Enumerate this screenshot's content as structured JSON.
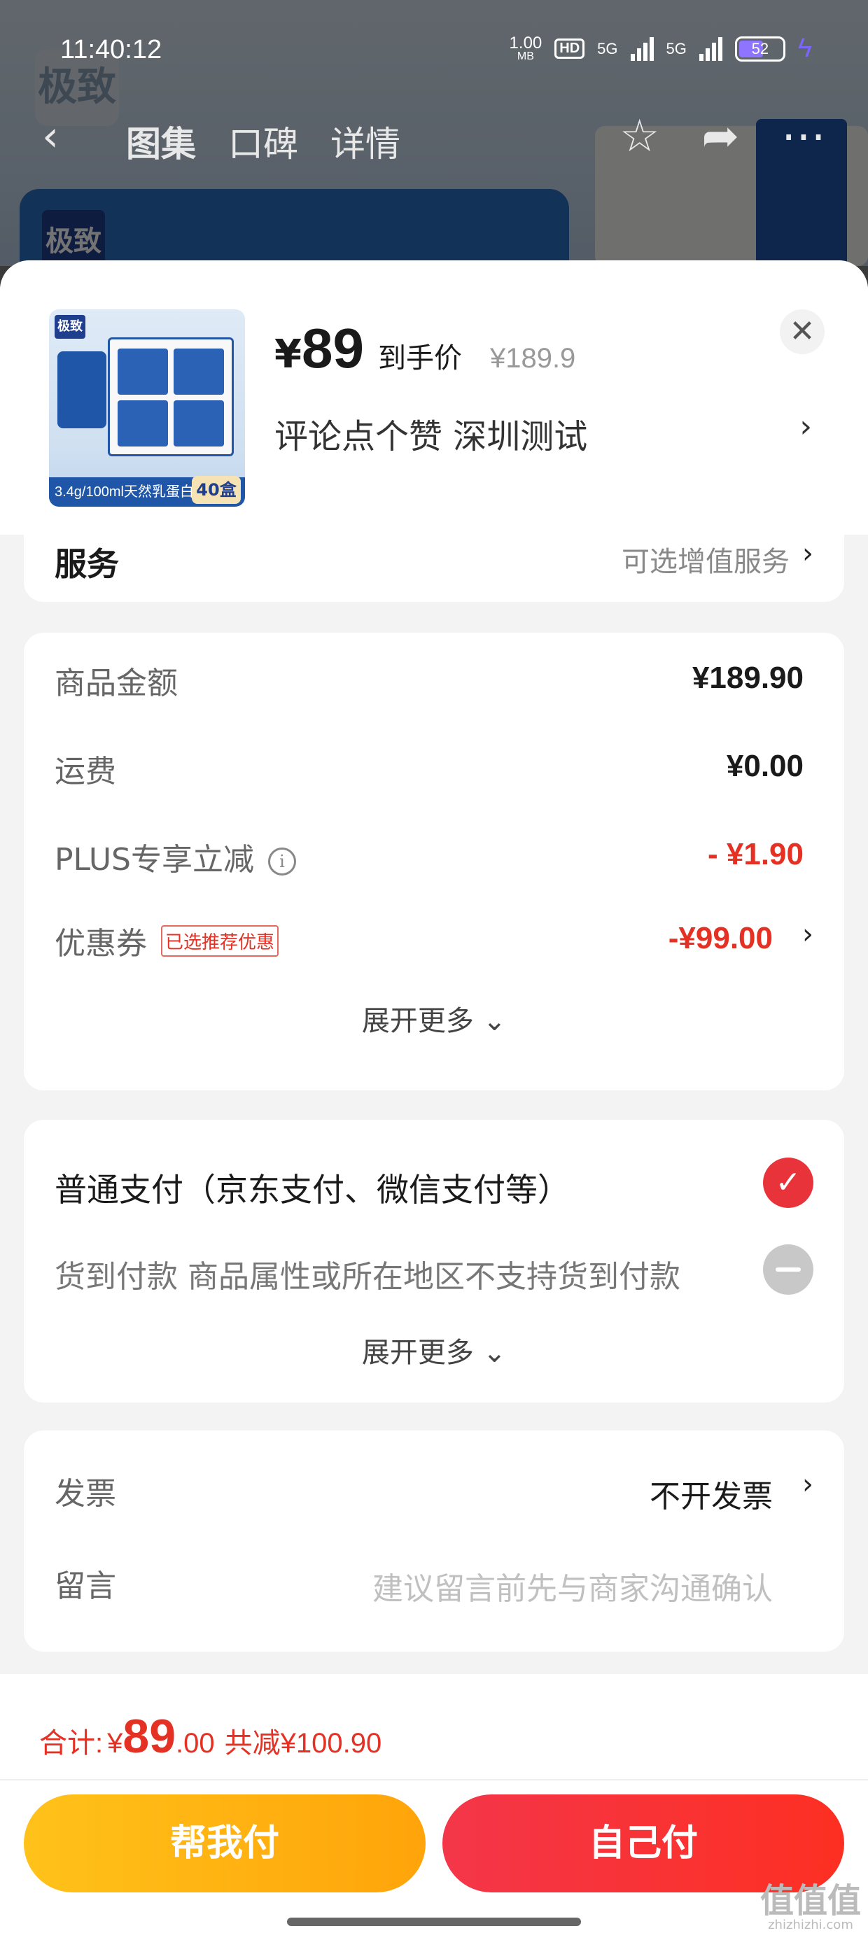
{
  "status": {
    "time": "11:40:12",
    "speed": "1.00",
    "speed_unit": "MB",
    "hd": "HD",
    "net1": "5G",
    "net2": "5G",
    "battery": "52"
  },
  "nav": {
    "tabs": [
      "图集",
      "口碑",
      "详情"
    ],
    "active_tab": 0
  },
  "background": {
    "logo_text": "极致"
  },
  "product": {
    "image_logo": "极致",
    "image_strip": "3.4g/100ml天然乳蛋白",
    "image_count": "40盒",
    "price_currency": "¥",
    "price": "89",
    "price_tag": "到手价",
    "original_price": "¥189.9",
    "description": "评论点个赞  深圳测试"
  },
  "service": {
    "label": "服务",
    "value": "可选增值服务"
  },
  "amounts": {
    "goods_label": "商品金额",
    "goods_value": "¥189.90",
    "shipping_label": "运费",
    "shipping_value": "¥0.00",
    "plus_label": "PLUS专享立减",
    "plus_value": "- ¥1.90",
    "coupon_label": "优惠券",
    "coupon_badge": "已选推荐优惠",
    "coupon_value": "-¥99.00",
    "expand_label": "展开更多"
  },
  "payment": {
    "normal_label": "普通支付（京东支付、微信支付等）",
    "cod_label": "货到付款 商品属性或所在地区不支持货到付款",
    "expand_label": "展开更多"
  },
  "invoice": {
    "invoice_label": "发票",
    "invoice_value": "不开发票",
    "message_label": "留言",
    "message_placeholder": "建议留言前先与商家沟通确认"
  },
  "bottom": {
    "total_label": "合计:",
    "total_currency": "¥",
    "total_int": "89",
    "total_dec": ".00",
    "total_saved": "共减¥100.90",
    "help_pay": "帮我付",
    "self_pay": "自己付"
  },
  "watermark": {
    "text": "值值值",
    "sub": "zhizhizhi.com"
  },
  "colors": {
    "accent_red": "#e53124",
    "pay_button": "#f4364a",
    "help_button": "#ffb414"
  }
}
